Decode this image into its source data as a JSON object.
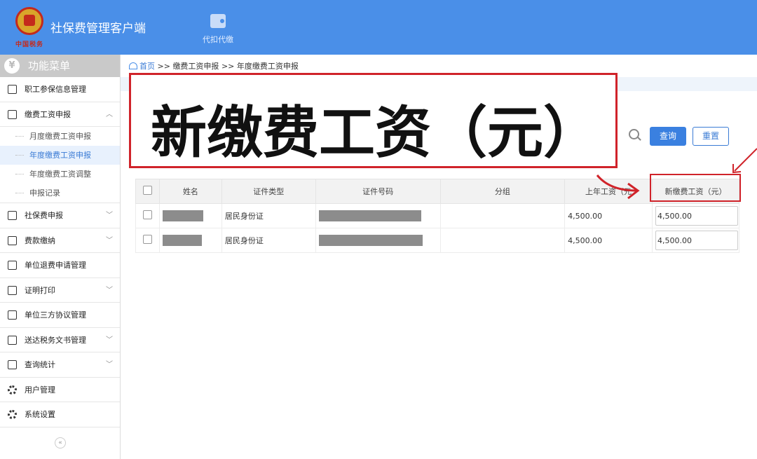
{
  "header": {
    "app_title": "社保费管理客户端",
    "logo_sub": "中国税务",
    "nav": [
      {
        "label": "代扣代缴",
        "icon": "wallet-icon"
      }
    ],
    "color": "#4a8fe8"
  },
  "sidebar": {
    "title": "功能菜单",
    "items": [
      {
        "label": "职工参保信息管理",
        "icon": "list-icon"
      },
      {
        "label": "缴费工资申报",
        "icon": "edit-icon",
        "expanded": true,
        "children": [
          {
            "label": "月度缴费工资申报"
          },
          {
            "label": "年度缴费工资申报",
            "active": true
          },
          {
            "label": "年度缴费工资调整"
          },
          {
            "label": "申报记录"
          }
        ]
      },
      {
        "label": "社保费申报",
        "icon": "calendar-icon"
      },
      {
        "label": "费款缴纳",
        "icon": "book-icon"
      },
      {
        "label": "单位退费申请管理",
        "icon": "list-icon"
      },
      {
        "label": "证明打印",
        "icon": "doc-icon"
      },
      {
        "label": "单位三方协议管理",
        "icon": "book-icon"
      },
      {
        "label": "送达税务文书管理",
        "icon": "print-icon"
      },
      {
        "label": "查询统计",
        "icon": "chart-icon"
      },
      {
        "label": "用户管理",
        "icon": "gear-icon"
      },
      {
        "label": "系统设置",
        "icon": "gear-icon"
      }
    ]
  },
  "breadcrumb": {
    "home": "首页",
    "sep": ">>",
    "level1": "缴费工资申报",
    "level2": "年度缴费工资申报"
  },
  "toolbar": {
    "query_label": "查询",
    "reset_label": "重置"
  },
  "callout": {
    "text": "新缴费工资（元）",
    "color": "#d0232a"
  },
  "table": {
    "headers": [
      "姓名",
      "证件类型",
      "证件号码",
      "分组",
      "上年工资（元）",
      "新缴费工资（元）"
    ],
    "prev_header_visible": "上年工资（元",
    "rows": [
      {
        "id_type": "居民身份证",
        "prev_wage": "4,500.00",
        "new_wage": "4,500.00"
      },
      {
        "id_type": "居民身份证",
        "prev_wage": "4,500.00",
        "new_wage": "4,500.00"
      }
    ]
  }
}
